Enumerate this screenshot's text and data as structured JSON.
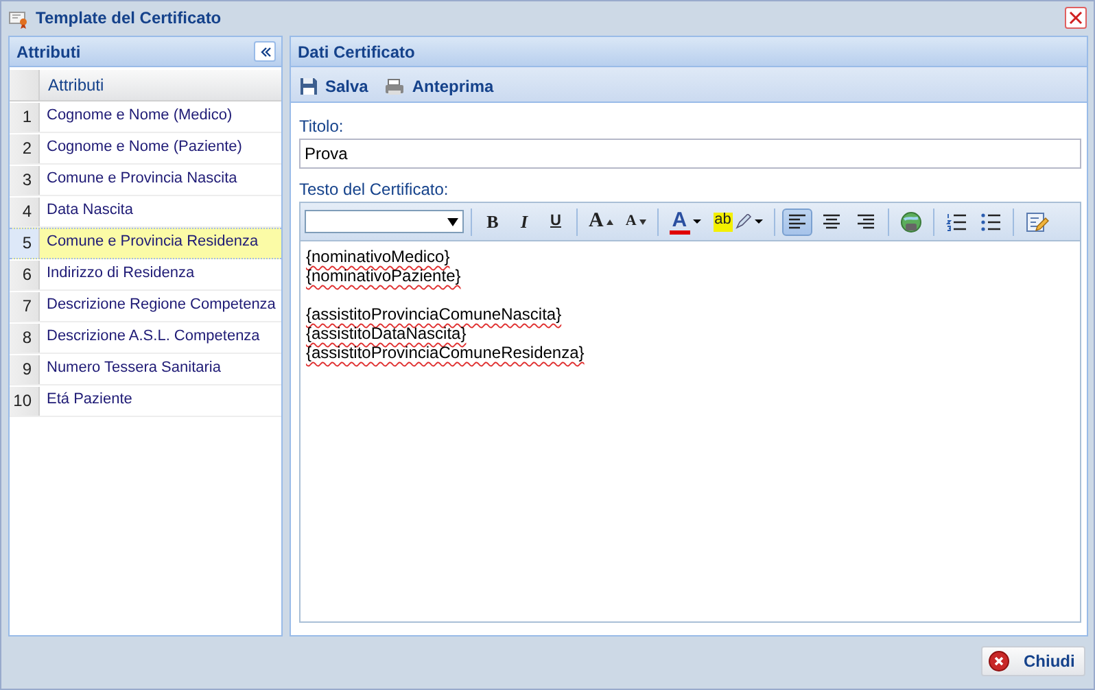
{
  "window": {
    "title": "Template del Certificato"
  },
  "attributes_panel": {
    "title": "Attributi",
    "column": "Attributi",
    "rows": [
      {
        "number": "1",
        "label": "Cognome e Nome (Medico)",
        "selected": false
      },
      {
        "number": "2",
        "label": "Cognome e Nome (Paziente)",
        "selected": false
      },
      {
        "number": "3",
        "label": "Comune e Provincia Nascita",
        "selected": false
      },
      {
        "number": "4",
        "label": "Data Nascita",
        "selected": false
      },
      {
        "number": "5",
        "label": "Comune e Provincia Residenza",
        "selected": true
      },
      {
        "number": "6",
        "label": "Indirizzo di Residenza",
        "selected": false
      },
      {
        "number": "7",
        "label": "Descrizione Regione Competenza",
        "selected": false
      },
      {
        "number": "8",
        "label": "Descrizione A.S.L. Competenza",
        "selected": false
      },
      {
        "number": "9",
        "label": "Numero Tessera Sanitaria",
        "selected": false
      },
      {
        "number": "10",
        "label": "Etá Paziente",
        "selected": false
      }
    ]
  },
  "certificate_panel": {
    "title": "Dati Certificato",
    "toolbar": [
      {
        "kind": "save",
        "label": "Salva"
      },
      {
        "kind": "preview",
        "label": "Anteprima"
      }
    ],
    "title_label": "Titolo:",
    "title_value": "Prova",
    "text_label": "Testo del Certificato:",
    "editor": {
      "toolbar_groups": [
        {
          "tools": [
            {
              "kind": "font-select"
            }
          ]
        },
        {
          "tools": [
            {
              "kind": "bold",
              "label": "B",
              "selected": false
            },
            {
              "kind": "italic",
              "label": "I",
              "selected": false
            },
            {
              "kind": "underline",
              "label": "U",
              "selected": false
            }
          ]
        },
        {
          "tools": [
            {
              "kind": "grow",
              "label": "A",
              "selected": false
            },
            {
              "kind": "shrink",
              "label": "A",
              "selected": false
            }
          ]
        },
        {
          "tools": [
            {
              "kind": "font-color",
              "label": "A",
              "selected": false
            },
            {
              "kind": "highlight",
              "label": "ab",
              "selected": false
            }
          ]
        },
        {
          "tools": [
            {
              "kind": "align-left",
              "selected": true
            },
            {
              "kind": "align-center",
              "selected": false
            },
            {
              "kind": "align-right",
              "selected": false
            }
          ]
        },
        {
          "tools": [
            {
              "kind": "link",
              "selected": false
            }
          ]
        },
        {
          "tools": [
            {
              "kind": "ordered-list",
              "selected": false
            },
            {
              "kind": "bullet-list",
              "selected": false
            }
          ]
        },
        {
          "tools": [
            {
              "kind": "source",
              "selected": false
            }
          ]
        }
      ],
      "paragraphs": [
        {
          "lines": [
            "{nominativoMedico}",
            "{nominativoPaziente}"
          ]
        },
        {
          "lines": [
            "{assistitoProvinciaComuneNascita}",
            "{assistitoDataNascita}",
            "{assistitoProvinciaComuneResidenza}"
          ]
        }
      ]
    }
  },
  "footer": {
    "close_button": "Chiudi"
  }
}
